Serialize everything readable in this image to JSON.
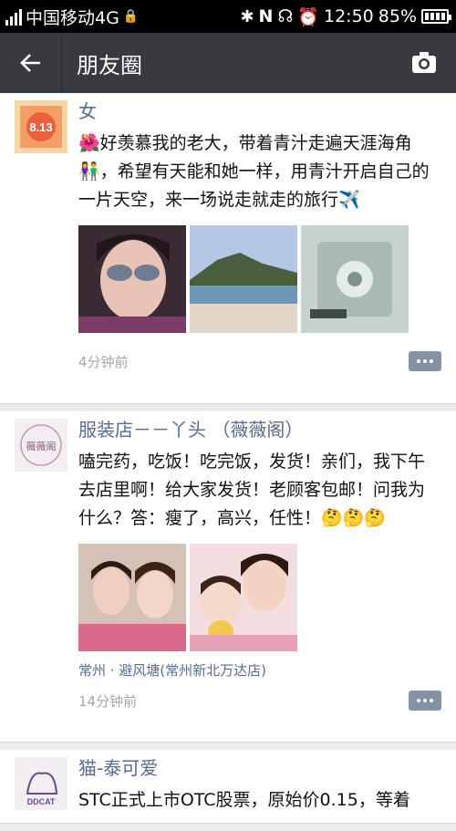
{
  "status": {
    "carrier": "中国移动4G",
    "time": "12:50",
    "battery": "85%"
  },
  "nav": {
    "title": "朋友圈"
  },
  "posts": [
    {
      "name": "女",
      "avatar_text": "8.13",
      "text": "🌺好羡慕我的老大，带着青汁走遍天涯海角👫，希望有天能和她一样，用青汁开启自己的一片天空，来一场说走就走的旅行✈️",
      "time": "4分钟前"
    },
    {
      "name": "服装店－－丫头 （薇薇阁）",
      "avatar_text": "薇薇阁",
      "text": "嗑完药，吃饭！吃完饭，发货！亲们，我下午去店里啊！给大家发货！老顾客包邮！问我为什么？答：瘦了，高兴，任性！🤔🤔🤔",
      "location": "常州 · 避风塘(常州新北万达店)",
      "time": "14分钟前"
    },
    {
      "name": "猫-泰可爱",
      "avatar_text": "DDCAT",
      "text": "STC正式上市OTC股票，原始价0.15，等着"
    }
  ]
}
